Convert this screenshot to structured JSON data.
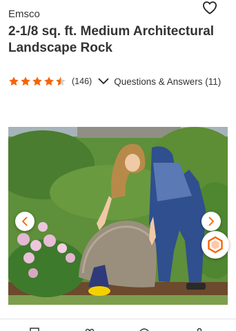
{
  "product": {
    "brand": "Emsco",
    "title": "2-1/8 sq. ft. Medium Architectural Landscape Rock",
    "rating": 4.5,
    "review_count": "(146)",
    "qa_label": "Questions & Answers (11)"
  },
  "icons": {
    "wishlist": "heart-icon",
    "rating_star": "star-icon",
    "expand": "chevron-down-icon",
    "previous": "chevron-left-icon",
    "next": "chevron-right-icon",
    "spin_view": "360-view-icon"
  },
  "colors": {
    "star": "#f96302",
    "text": "#333333",
    "accent": "#f96302"
  }
}
